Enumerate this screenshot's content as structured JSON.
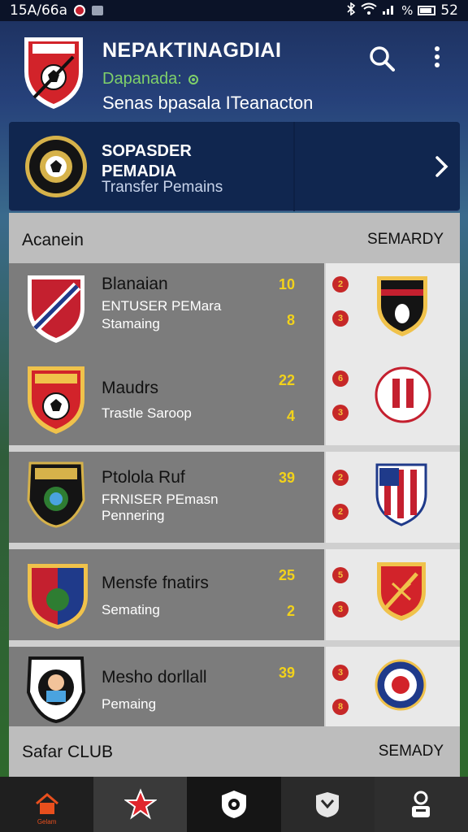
{
  "status_bar": {
    "time": "15A/66a",
    "right_text": "52"
  },
  "header": {
    "title": "NEPAKTINAGDIAI",
    "subtitle": "Dapanada:",
    "tagline": "Senas bpasala ITeanacton"
  },
  "featured": {
    "title_line1": "SOPASDER",
    "title_line2": "PEMADIA",
    "subtitle": "Transfer Pemains"
  },
  "list": {
    "header_left": "Acanein",
    "header_right": "SEMARDY",
    "footer_left": "Safar CLUB",
    "footer_right": "SEMADY",
    "rows": [
      {
        "name": "Blanaian",
        "sub1": "ENTUSER PEMara",
        "sub2": "Stamaing",
        "score_top": "10",
        "score_bot": "8",
        "pip_top": "2",
        "pip_bot": "3"
      },
      {
        "name": "Maudrs",
        "sub1": "",
        "sub2": "Trastle Saroop",
        "score_top": "22",
        "score_bot": "4",
        "pip_top": "6",
        "pip_bot": "3"
      },
      {
        "name": "Ptolola Ruf",
        "sub1": "FRNISER PEmasn",
        "sub2": "Pennering",
        "score_top": "39",
        "score_bot": "",
        "pip_top": "2",
        "pip_bot": "2"
      },
      {
        "name": "Mensfe fnatirs",
        "sub1": "",
        "sub2": "Semating",
        "score_top": "25",
        "score_bot": "2",
        "pip_top": "5",
        "pip_bot": "3"
      },
      {
        "name": "Mesho dorllall",
        "sub1": "",
        "sub2": "Pemaing",
        "score_top": "39",
        "score_bot": "",
        "pip_top": "3",
        "pip_bot": "8"
      }
    ]
  },
  "bottom_nav": {
    "home_label": "Gelam"
  },
  "colors": {
    "accent": "#c4202f",
    "score": "#f2d21b",
    "header_bg": "#10264f"
  }
}
